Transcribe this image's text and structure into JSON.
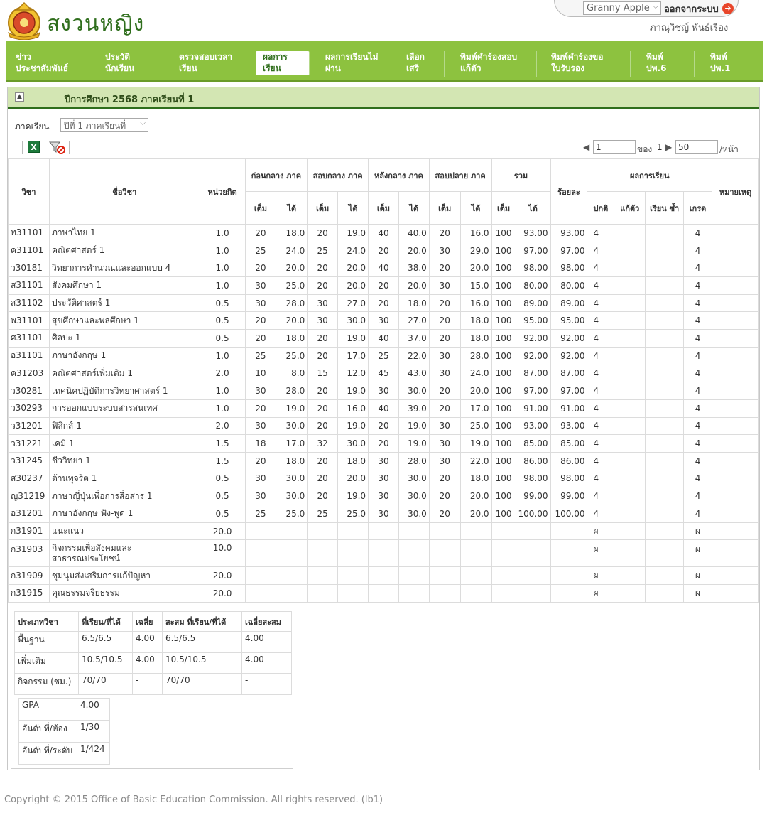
{
  "header": {
    "school_name": "สงวนหญิง",
    "user_select_value": "Granny Apple",
    "logout_label": "ออกจากระบบ",
    "user_fullname": "ภาณุวิชญ์  พันธ์เรือง"
  },
  "nav": {
    "items": [
      {
        "line1": "ข่าว",
        "line2": "ประชาสัมพันธ์"
      },
      {
        "line1": "ประวัติ",
        "line2": "นักเรียน"
      },
      {
        "line1": "ตรวจสอบเวลา",
        "line2": "เรียน"
      },
      {
        "line1": "ผลการ",
        "line2": "เรียน"
      },
      {
        "line1": "ผลการเรียนไม่",
        "line2": "ผ่าน"
      },
      {
        "line1": "เลือก",
        "line2": "เสรี"
      },
      {
        "line1": "พิมพ์คำร้องสอบ",
        "line2": "แก้ตัว"
      },
      {
        "line1": "พิมพ์คำร้องขอ",
        "line2": "ใบรับรอง"
      },
      {
        "line1": "พิมพ์",
        "line2": "ปพ.6"
      },
      {
        "line1": "พิมพ์",
        "line2": "ปพ.1"
      }
    ],
    "active_index": 3
  },
  "panel": {
    "title": "ปีการศึกษา  2568  ภาคเรียนที่  1",
    "semester_label": "ภาคเรียน",
    "semester_value": "ปีที่  1  ภาคเรียนที่"
  },
  "toolbar": {
    "excel_icon": "X",
    "page_value": "1",
    "of_label": "ของ",
    "total_pages": "1",
    "page_size": "50",
    "per_page_label": "/หน้า"
  },
  "table": {
    "headers": {
      "code": "วิชา",
      "name": "ชื่อวิชา",
      "credit": "หน่วยกิต",
      "pre_mid": "ก่อนกลาง ภาค",
      "mid": "สอบกลาง ภาค",
      "post_mid": "หลังกลาง ภาค",
      "final": "สอบปลาย ภาค",
      "total": "รวม",
      "percent": "ร้อยละ",
      "result": "ผลการเรียน",
      "note": "หมายเหตุ",
      "full": "เต็ม",
      "got": "ได้",
      "normal": "ปกติ",
      "retest": "แก้ตัว",
      "repeat": "เรียน ซ้ำ",
      "grade": "เกรด"
    },
    "rows": [
      {
        "code": "ท31101",
        "name": "ภาษาไทย  1",
        "credit": "1.0",
        "pf": "20",
        "pg": "18.0",
        "mf": "20",
        "mg": "19.0",
        "af": "40",
        "ag": "40.0",
        "ff": "20",
        "fg": "16.0",
        "tf": "100",
        "tg": "93.00",
        "pct": "93.00",
        "normal": "4",
        "grade": "4"
      },
      {
        "code": "ค31101",
        "name": "คณิตศาสตร์  1",
        "credit": "1.0",
        "pf": "25",
        "pg": "24.0",
        "mf": "25",
        "mg": "24.0",
        "af": "20",
        "ag": "20.0",
        "ff": "30",
        "fg": "29.0",
        "tf": "100",
        "tg": "97.00",
        "pct": "97.00",
        "normal": "4",
        "grade": "4"
      },
      {
        "code": "ว30181",
        "name": "วิทยาการคำนวณและออกแบบ  4",
        "credit": "1.0",
        "pf": "20",
        "pg": "20.0",
        "mf": "20",
        "mg": "20.0",
        "af": "40",
        "ag": "38.0",
        "ff": "20",
        "fg": "20.0",
        "tf": "100",
        "tg": "98.00",
        "pct": "98.00",
        "normal": "4",
        "grade": "4"
      },
      {
        "code": "ส31101",
        "name": "สังคมศึกษา  1",
        "credit": "1.0",
        "pf": "30",
        "pg": "25.0",
        "mf": "20",
        "mg": "20.0",
        "af": "20",
        "ag": "20.0",
        "ff": "30",
        "fg": "15.0",
        "tf": "100",
        "tg": "80.00",
        "pct": "80.00",
        "normal": "4",
        "grade": "4"
      },
      {
        "code": "ส31102",
        "name": "ประวัติศาสตร์  1",
        "credit": "0.5",
        "pf": "30",
        "pg": "28.0",
        "mf": "30",
        "mg": "27.0",
        "af": "20",
        "ag": "18.0",
        "ff": "20",
        "fg": "16.0",
        "tf": "100",
        "tg": "89.00",
        "pct": "89.00",
        "normal": "4",
        "grade": "4"
      },
      {
        "code": "พ31101",
        "name": "สุขศึกษาและพลศึกษา  1",
        "credit": "0.5",
        "pf": "20",
        "pg": "20.0",
        "mf": "30",
        "mg": "30.0",
        "af": "30",
        "ag": "27.0",
        "ff": "20",
        "fg": "18.0",
        "tf": "100",
        "tg": "95.00",
        "pct": "95.00",
        "normal": "4",
        "grade": "4"
      },
      {
        "code": "ศ31101",
        "name": "ศิลปะ  1",
        "credit": "0.5",
        "pf": "20",
        "pg": "18.0",
        "mf": "20",
        "mg": "19.0",
        "af": "40",
        "ag": "37.0",
        "ff": "20",
        "fg": "18.0",
        "tf": "100",
        "tg": "92.00",
        "pct": "92.00",
        "normal": "4",
        "grade": "4"
      },
      {
        "code": "อ31101",
        "name": "ภาษาอังกฤษ  1",
        "credit": "1.0",
        "pf": "25",
        "pg": "25.0",
        "mf": "20",
        "mg": "17.0",
        "af": "25",
        "ag": "22.0",
        "ff": "30",
        "fg": "28.0",
        "tf": "100",
        "tg": "92.00",
        "pct": "92.00",
        "normal": "4",
        "grade": "4"
      },
      {
        "code": "ค31203",
        "name": "คณิตศาสตร์เพิ่มเติม  1",
        "credit": "2.0",
        "pf": "10",
        "pg": "8.0",
        "mf": "15",
        "mg": "12.0",
        "af": "45",
        "ag": "43.0",
        "ff": "30",
        "fg": "24.0",
        "tf": "100",
        "tg": "87.00",
        "pct": "87.00",
        "normal": "4",
        "grade": "4"
      },
      {
        "code": "ว30281",
        "name": "เทคนิคปฏิบัติการวิทยาศาสตร์  1",
        "credit": "1.0",
        "pf": "30",
        "pg": "28.0",
        "mf": "20",
        "mg": "19.0",
        "af": "30",
        "ag": "30.0",
        "ff": "20",
        "fg": "20.0",
        "tf": "100",
        "tg": "97.00",
        "pct": "97.00",
        "normal": "4",
        "grade": "4"
      },
      {
        "code": "ว30293",
        "name": "การออกแบบระบบสารสนเทศ",
        "credit": "1.0",
        "pf": "20",
        "pg": "19.0",
        "mf": "20",
        "mg": "16.0",
        "af": "40",
        "ag": "39.0",
        "ff": "20",
        "fg": "17.0",
        "tf": "100",
        "tg": "91.00",
        "pct": "91.00",
        "normal": "4",
        "grade": "4"
      },
      {
        "code": "ว31201",
        "name": "ฟิสิกส์  1",
        "credit": "2.0",
        "pf": "30",
        "pg": "30.0",
        "mf": "20",
        "mg": "19.0",
        "af": "20",
        "ag": "19.0",
        "ff": "30",
        "fg": "25.0",
        "tf": "100",
        "tg": "93.00",
        "pct": "93.00",
        "normal": "4",
        "grade": "4"
      },
      {
        "code": "ว31221",
        "name": "เคมี  1",
        "credit": "1.5",
        "pf": "18",
        "pg": "17.0",
        "mf": "32",
        "mg": "30.0",
        "af": "20",
        "ag": "19.0",
        "ff": "30",
        "fg": "19.0",
        "tf": "100",
        "tg": "85.00",
        "pct": "85.00",
        "normal": "4",
        "grade": "4"
      },
      {
        "code": "ว31245",
        "name": "ชีววิทยา  1",
        "credit": "1.5",
        "pf": "20",
        "pg": "18.0",
        "mf": "20",
        "mg": "18.0",
        "af": "30",
        "ag": "28.0",
        "ff": "30",
        "fg": "22.0",
        "tf": "100",
        "tg": "86.00",
        "pct": "86.00",
        "normal": "4",
        "grade": "4"
      },
      {
        "code": "ส30237",
        "name": "ต้านทุจริต  1",
        "credit": "0.5",
        "pf": "30",
        "pg": "30.0",
        "mf": "20",
        "mg": "20.0",
        "af": "30",
        "ag": "30.0",
        "ff": "20",
        "fg": "18.0",
        "tf": "100",
        "tg": "98.00",
        "pct": "98.00",
        "normal": "4",
        "grade": "4"
      },
      {
        "code": "ญ31219",
        "name": "ภาษาญี่ปุ่นเพื่อการสื่อสาร  1",
        "credit": "0.5",
        "pf": "30",
        "pg": "30.0",
        "mf": "20",
        "mg": "19.0",
        "af": "30",
        "ag": "30.0",
        "ff": "20",
        "fg": "20.0",
        "tf": "100",
        "tg": "99.00",
        "pct": "99.00",
        "normal": "4",
        "grade": "4"
      },
      {
        "code": "อ31201",
        "name": "ภาษาอังกฤษ  ฟัง-พูด  1",
        "credit": "0.5",
        "pf": "25",
        "pg": "25.0",
        "mf": "25",
        "mg": "25.0",
        "af": "30",
        "ag": "30.0",
        "ff": "20",
        "fg": "20.0",
        "tf": "100",
        "tg": "100.00",
        "pct": "100.00",
        "normal": "4",
        "grade": "4"
      },
      {
        "code": "ก31901",
        "name": "แนะแนว",
        "credit": "20.0",
        "normal": "ผ",
        "grade": "ผ"
      },
      {
        "code": "ก31903",
        "name": "กิจกรรมเพื่อสังคมและสาธารณประโยชน์",
        "credit": "10.0",
        "normal": "ผ",
        "grade": "ผ",
        "tall": true
      },
      {
        "code": "ก31909",
        "name": "ชุมนุมส่งเสริมการแก้ปัญหา",
        "credit": "20.0",
        "normal": "ผ",
        "grade": "ผ"
      },
      {
        "code": "ก31915",
        "name": "คุณธรรมจริยธรรม",
        "credit": "20.0",
        "normal": "ผ",
        "grade": "ผ"
      }
    ]
  },
  "summary": {
    "headers": [
      "ประเภทวิชา",
      "ที่เรียน/ที่ได้",
      "เฉลี่ย",
      "สะสม  ที่เรียน/ที่ได้",
      "เฉลี่ยสะสม"
    ],
    "rows": [
      [
        "พื้นฐาน",
        "6.5/6.5",
        "4.00",
        "6.5/6.5",
        "4.00"
      ],
      [
        "เพิ่มเติม",
        "10.5/10.5",
        "4.00",
        "10.5/10.5",
        "4.00"
      ],
      [
        "กิจกรรม  (ชม.)",
        "70/70",
        "-",
        "70/70",
        "-"
      ]
    ],
    "gpa": [
      [
        "GPA",
        "4.00"
      ],
      [
        "อันดับที่/ห้อง",
        "1/30"
      ],
      [
        "อันดับที่/ระดับ",
        "1/424"
      ]
    ]
  },
  "footer": {
    "copyright": "Copyright © 2015 Office of Basic Education Commission. All rights reserved. (lb1)"
  }
}
